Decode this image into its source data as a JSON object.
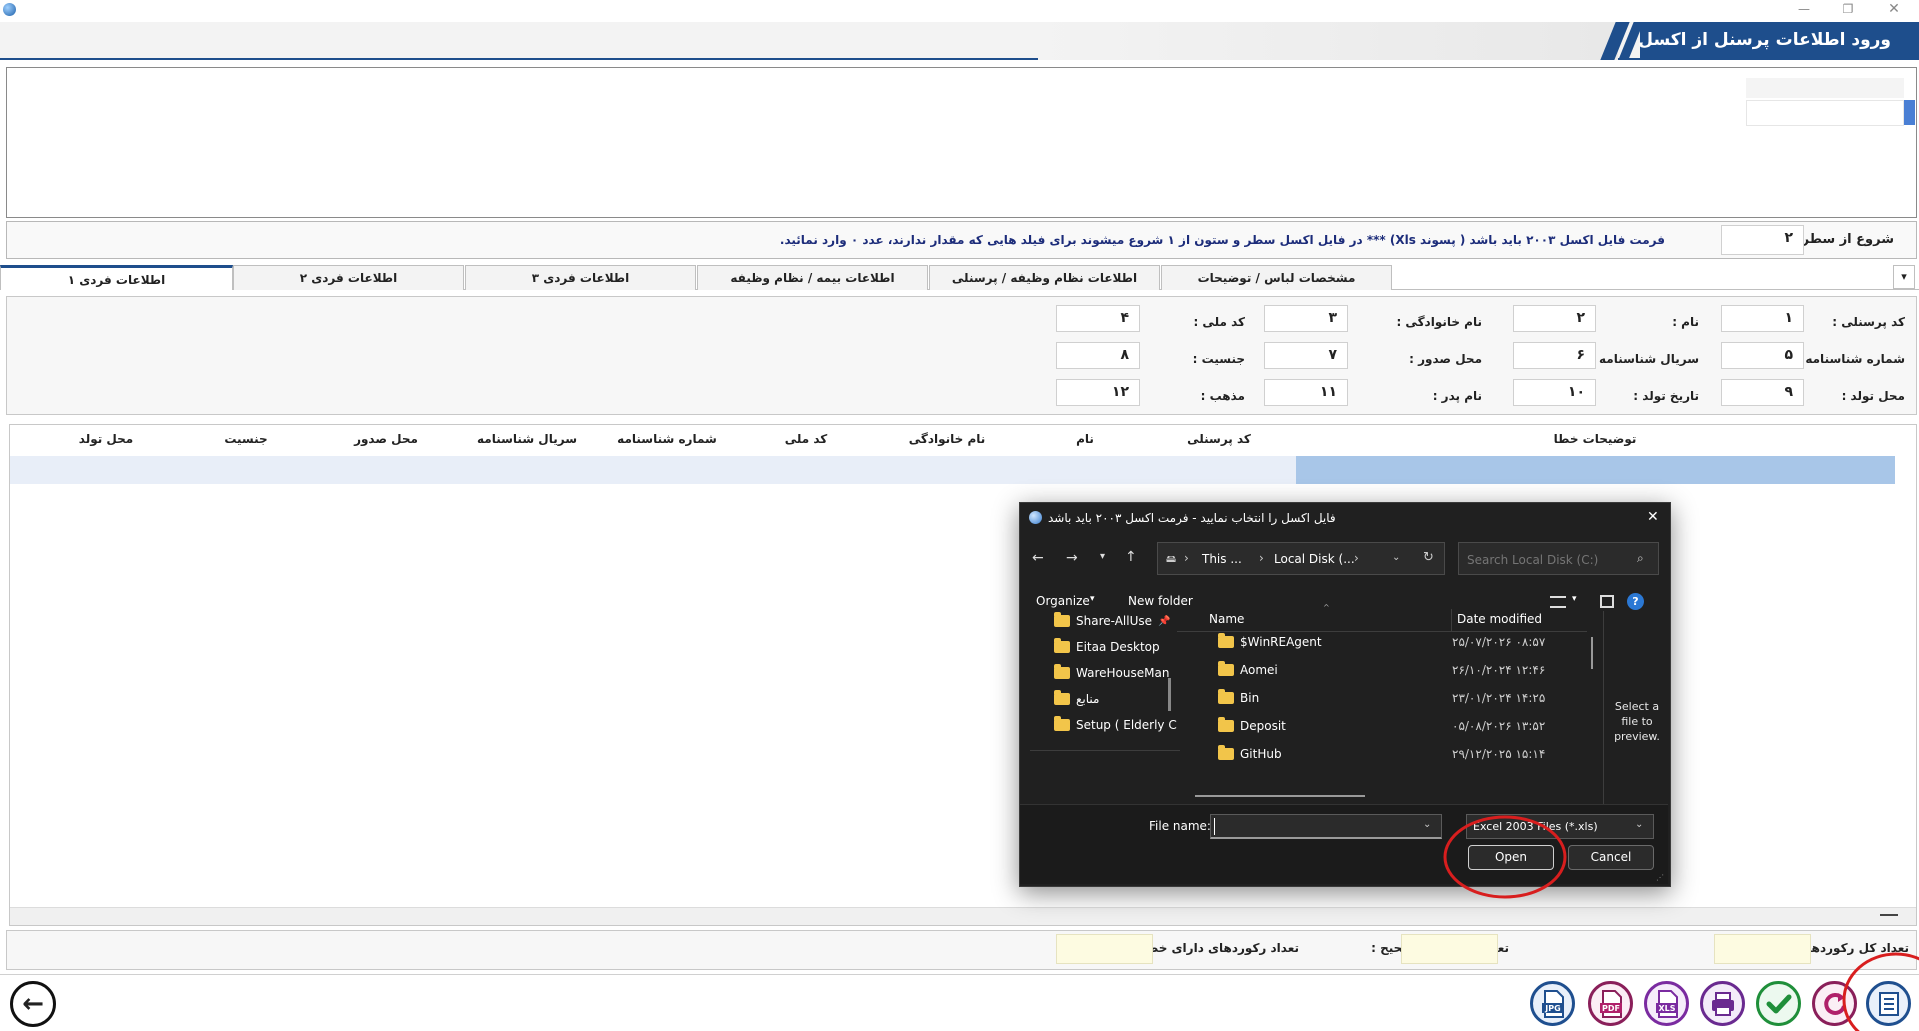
{
  "window": {
    "title": "ورود اطلاعات پرسنل از اکسل",
    "min_glyph": "—",
    "restore_glyph": "❐",
    "close_glyph": "✕"
  },
  "start_row": {
    "label": "شروع از سطر :",
    "value": "۲",
    "note": "فرمت فایل اکسل ۲۰۰۳ باید باشد ( پسوند Xls) *** در فایل اکسل سطر و ستون از ۱ شروع میشوند   برای فیلد هایی که مقدار ندارند، عدد ۰ وارد نمائید."
  },
  "tabs": [
    {
      "label": "اطلاعات فردی ۱",
      "active": true
    },
    {
      "label": "اطلاعات فردی ۲",
      "active": false
    },
    {
      "label": "اطلاعات فردی ۳",
      "active": false
    },
    {
      "label": "اطلاعات بیمه / نظام وظیفه",
      "active": false
    },
    {
      "label": "اطلاعات نظام وظیفه / پرسنلی",
      "active": false
    },
    {
      "label": "مشخصات لباس / توضیحات",
      "active": false
    }
  ],
  "tab_scroll_glyph": "▾",
  "fields": [
    {
      "label": "کد پرسنلی :",
      "value": "۱"
    },
    {
      "label": "نام :",
      "value": "۲"
    },
    {
      "label": "نام خانوادگی :",
      "value": "۳"
    },
    {
      "label": "کد ملی :",
      "value": "۴"
    },
    {
      "label": "شماره شناسنامه :",
      "value": "۵"
    },
    {
      "label": "سریال شناسنامه :",
      "value": "۶"
    },
    {
      "label": "محل صدور :",
      "value": "۷"
    },
    {
      "label": "جنسیت :",
      "value": "۸"
    },
    {
      "label": "محل تولد :",
      "value": "۹"
    },
    {
      "label": "تاریخ تولد :",
      "value": "۱۰"
    },
    {
      "label": "نام پدر :",
      "value": "۱۱"
    },
    {
      "label": "مذهب :",
      "value": "۱۲"
    }
  ],
  "grid": {
    "columns": [
      "توضیحات خطا",
      "کد پرسنلی",
      "نام",
      "نام خانوادگی",
      "کد ملی",
      "شماره شناسنامه",
      "سریال شناسنامه",
      "محل صدور",
      "جنسیت",
      "محل تولد"
    ]
  },
  "footer": {
    "total_label": "تعداد کل رکوردها :",
    "valid_label": "تعداد رکوردهای صحیح :",
    "error_label": "تعداد رکوردهای دارای خطا :"
  },
  "toolbar": {
    "back_glyph": "←",
    "jpg": "JPG",
    "pdf": "PDF",
    "xls": "XLS"
  },
  "dialog": {
    "title": "فایل اکسل را انتخاب نمایید - فرمت اکسل ۲۰۰۳ باید باشد",
    "close_glyph": "✕",
    "breadcrumb": [
      "This ...",
      "Local Disk (...",
      ""
    ],
    "search_placeholder": "Search Local Disk (C:)",
    "organize": "Organize",
    "new_folder": "New folder",
    "help": "?",
    "nav_items": [
      {
        "label": "Share-AllUse"
      },
      {
        "label": "Eitaa Desktop"
      },
      {
        "label": "WareHouseMan"
      },
      {
        "label": "منابع"
      },
      {
        "label": "Setup ( Elderly C"
      }
    ],
    "col_name": "Name",
    "col_date": "Date modified",
    "files": [
      {
        "name": "$WinREAgent",
        "date": "۲۵/۰۷/۲۰۲۶ ۰۸:۵۷"
      },
      {
        "name": "Aomei",
        "date": "۲۶/۱۰/۲۰۲۴ ۱۲:۴۶"
      },
      {
        "name": "Bin",
        "date": "۲۳/۰۱/۲۰۲۴ ۱۴:۲۵"
      },
      {
        "name": "Deposit",
        "date": "۰۵/۰۸/۲۰۲۶ ۱۳:۵۲"
      },
      {
        "name": "GitHub",
        "date": "۲۹/۱۲/۲۰۲۵ ۱۵:۱۴"
      }
    ],
    "preview_text": "Select a file to preview.",
    "file_name_label": "File name:",
    "file_name_value": "",
    "file_type": "Excel 2003 Files (*.xls)",
    "open": "Open",
    "cancel": "Cancel"
  },
  "colors": {
    "accent": "#1e4e8c",
    "selection": "#a8c6e8",
    "highlight_circle": "#d81e1e",
    "dialog_bg": "#202020",
    "footer_box": "#fdfbe1"
  }
}
